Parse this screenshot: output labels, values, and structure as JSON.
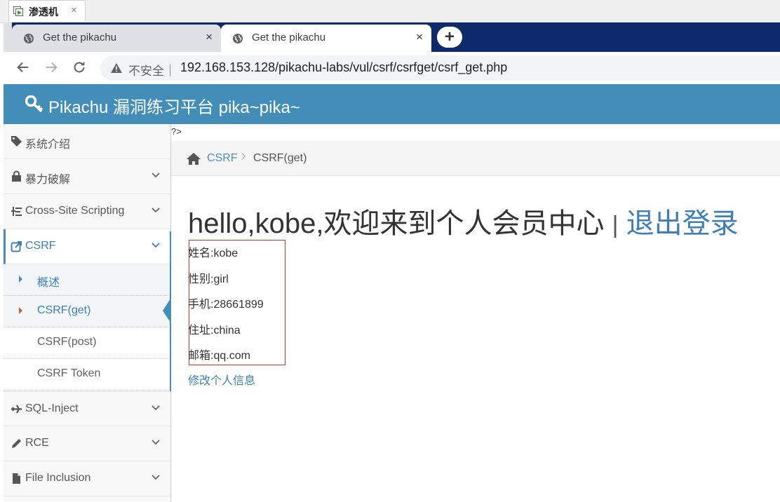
{
  "vm": {
    "title": "渗透机",
    "close": "×"
  },
  "browser": {
    "tabs": [
      {
        "label": "Get the pikachu",
        "close": "×"
      },
      {
        "label": "Get the pikachu",
        "close": "×"
      }
    ],
    "new_tab": "+",
    "security_label": "不安全",
    "url": "192.168.153.128/pikachu-labs/vul/csrf/csrfget/csrf_get.php"
  },
  "header": {
    "brand": "Pikachu 漏洞练习平台 pika~pika~"
  },
  "sidebar": {
    "items": [
      {
        "label": "系统介绍",
        "icon": "tags-icon"
      },
      {
        "label": "暴力破解",
        "icon": "lock-icon"
      },
      {
        "label": "Cross-Site Scripting",
        "icon": "list-icon"
      },
      {
        "label": "CSRF",
        "icon": "share-icon"
      },
      {
        "label": "SQL-Inject",
        "icon": "plane-icon"
      },
      {
        "label": "RCE",
        "icon": "pencil-icon"
      },
      {
        "label": "File Inclusion",
        "icon": "file-icon"
      }
    ],
    "csrf_sub": [
      {
        "label": "概述"
      },
      {
        "label": "CSRF(get)"
      },
      {
        "label": "CSRF(post)"
      },
      {
        "label": "CSRF Token"
      }
    ]
  },
  "content": {
    "php_leak": "?>",
    "breadcrumb": {
      "section": "CSRF",
      "separator": ">",
      "page": "CSRF(get)"
    },
    "greeting": "hello,kobe,欢迎来到个人会员中心",
    "divider": "|",
    "logout": "退出登录",
    "info": [
      "姓名:kobe",
      "性别:girl",
      "手机:28661899",
      "住址:china",
      "邮箱:qq.com"
    ],
    "edit_link": "修改个人信息"
  },
  "colors": {
    "brand": "#438eb9",
    "link": "#3f7fb6",
    "highlight_box": "#d9302b",
    "tabstrip": "#0f2a6b"
  }
}
